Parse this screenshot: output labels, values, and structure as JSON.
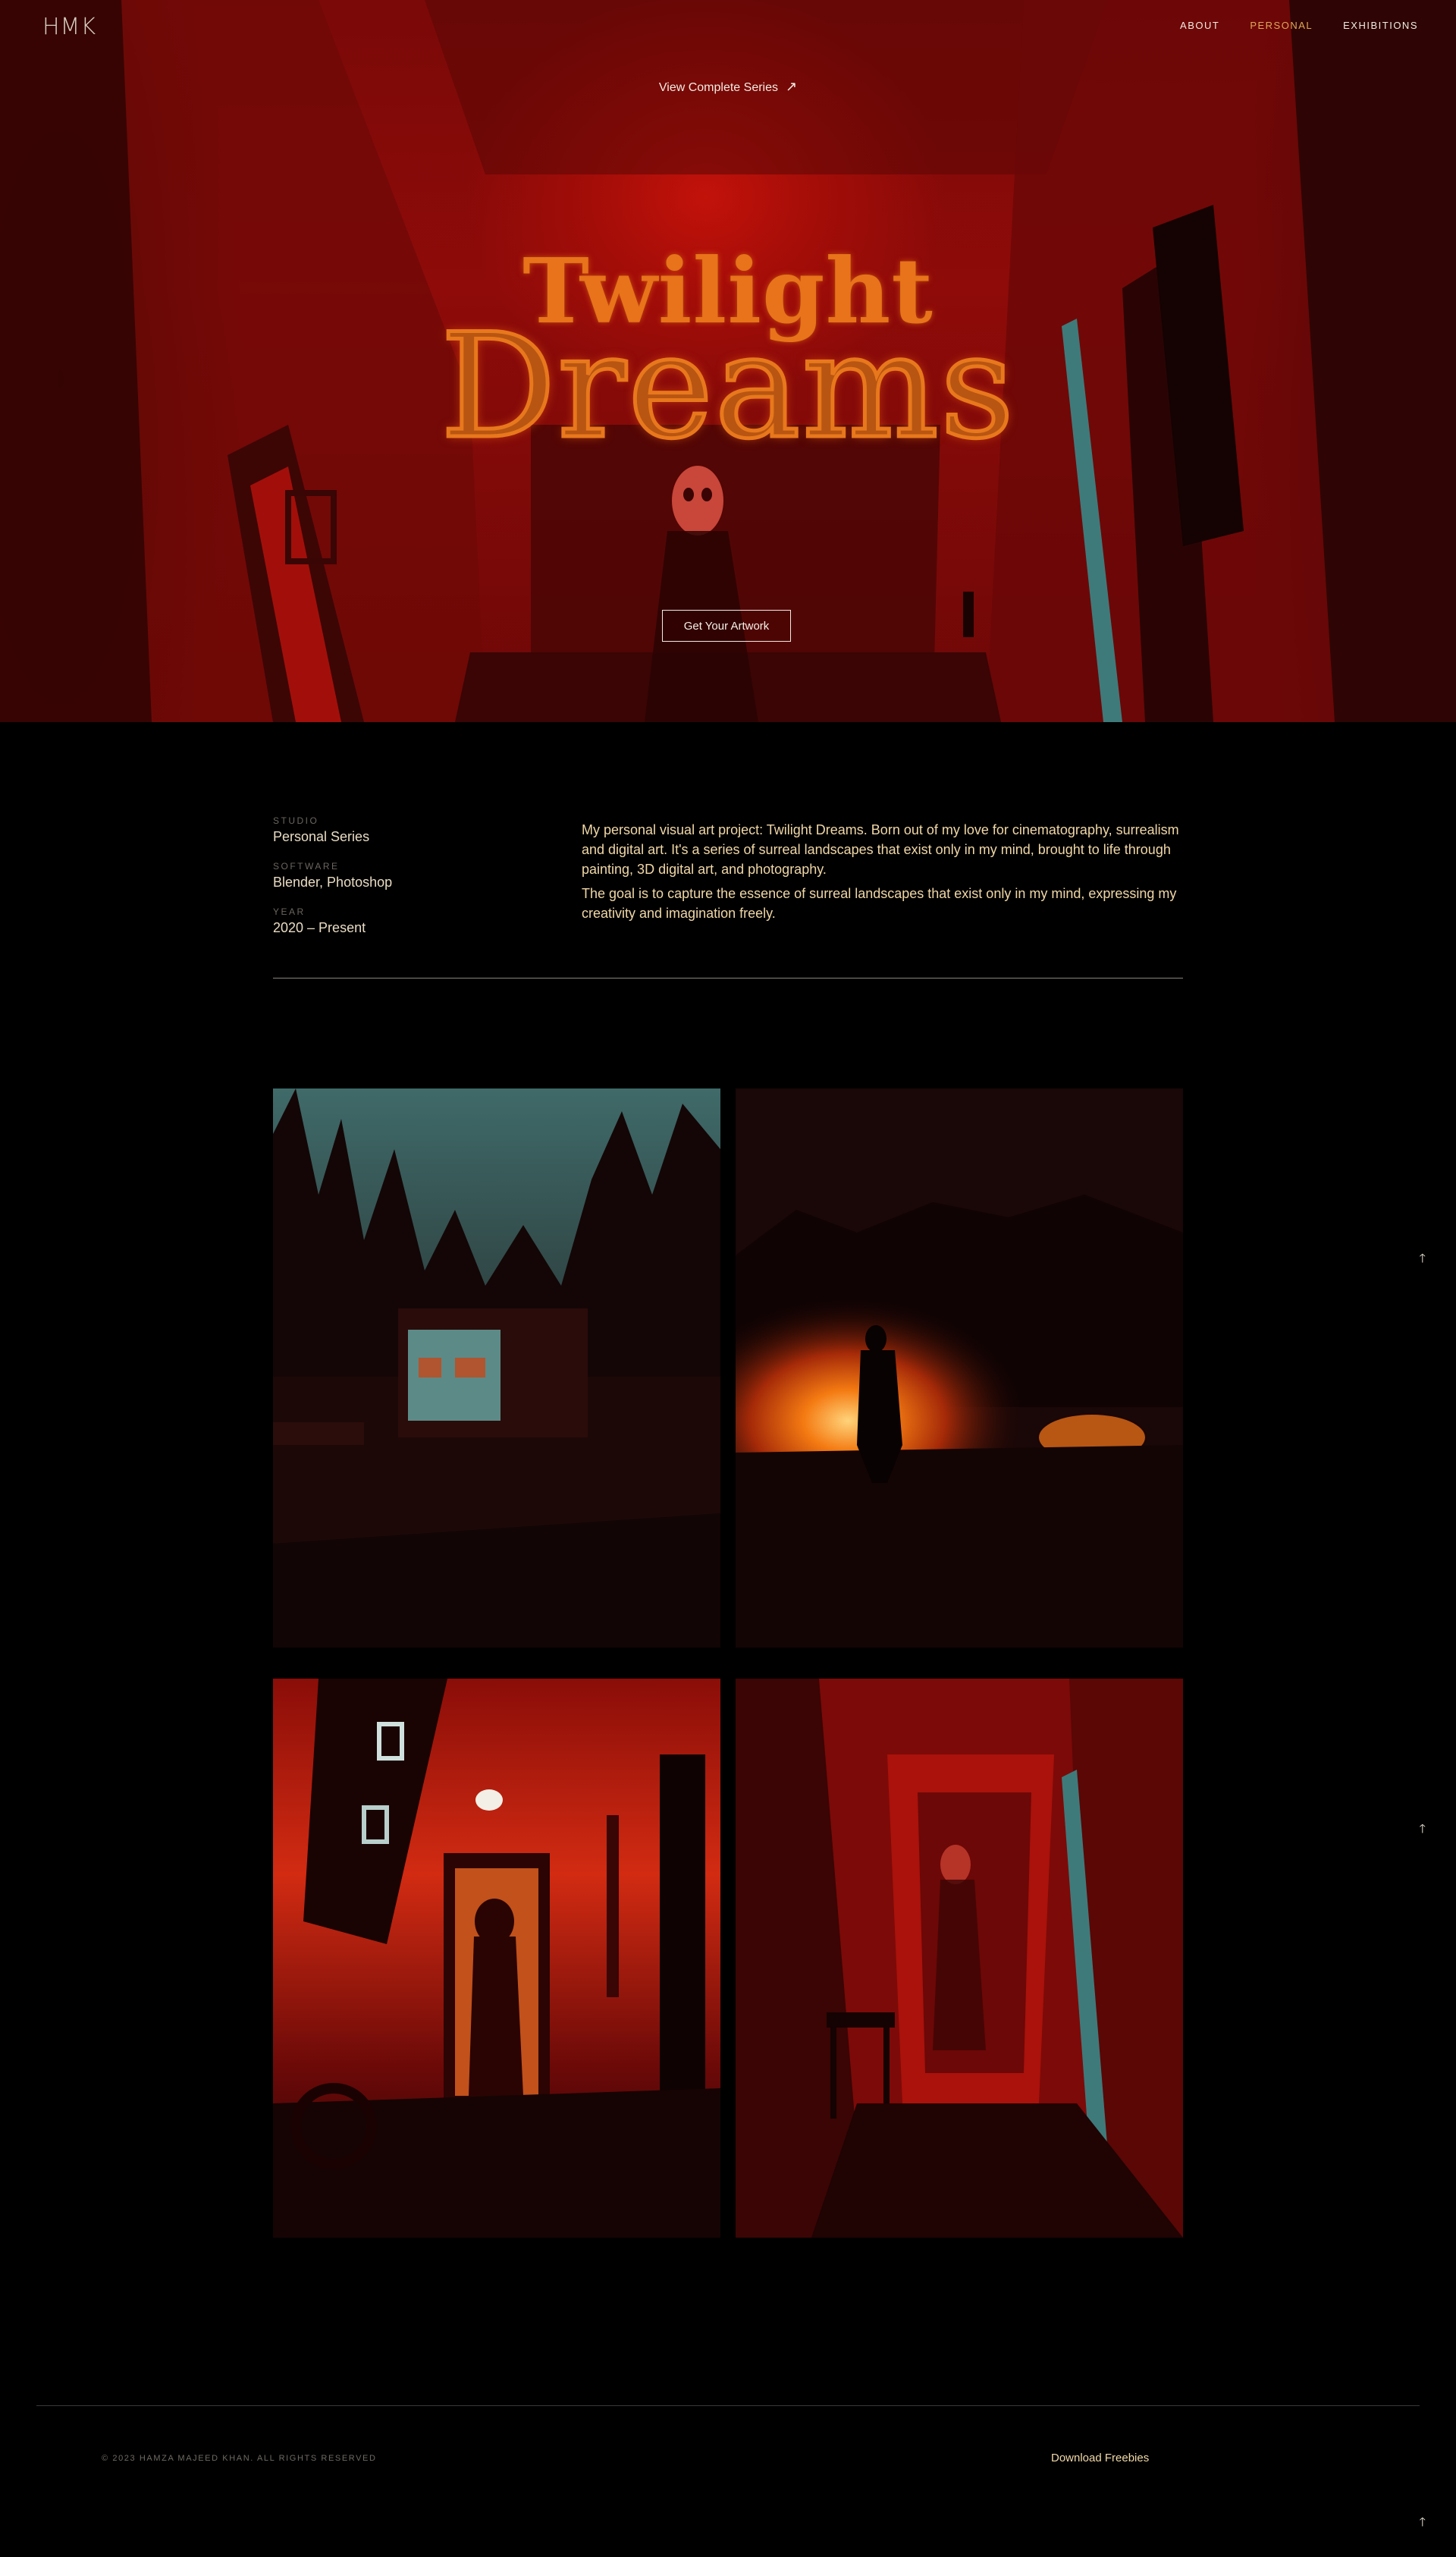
{
  "brand": {
    "logo": "HMK"
  },
  "nav": {
    "items": [
      "ABOUT",
      "PERSONAL",
      "EXHIBITIONS"
    ],
    "active": "PERSONAL",
    "active_color": "#e0a85a"
  },
  "hero": {
    "view_series_label": "View Complete Series",
    "view_series_icon": "arrow-up-right-icon",
    "title_line1": "Twilight",
    "title_line2": "Dreams",
    "cta_label": "Get Your Artwork",
    "title_color": "#e8731a",
    "background_color": "#8e0b09"
  },
  "info": {
    "meta": [
      {
        "label": "STUDIO",
        "value": "Personal Series"
      },
      {
        "label": "SOFTWARE",
        "value": "Blender, Photoshop"
      },
      {
        "label": "YEAR",
        "value": "2020 – Present"
      }
    ],
    "description": [
      "My personal visual art project: Twilight Dreams. Born out of my love for cinematography, surrealism and digital art. It's a series of surreal landscapes that exist only in my mind, brought to life through painting, 3D digital art, and photography.",
      "The goal is to capture the essence of surreal landscapes that exist only in my mind, expressing my creativity and imagination freely."
    ],
    "description_color": "#f0d7a6"
  },
  "gallery": {
    "images": [
      "forest-cabin-image",
      "bonfire-figure-image",
      "phone-booth-desert-image",
      "red-hallway-image"
    ]
  },
  "scroll_top_icon": "arrow-up-icon",
  "footer": {
    "copyright": "© 2023 HAMZA MAJEED KHAN. ALL RIGHTS RESERVED",
    "freebies_label": "Download Freebies"
  }
}
